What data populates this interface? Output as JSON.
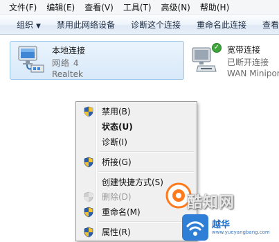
{
  "menubar": {
    "items": [
      "文件(F)",
      "编辑(E)",
      "查看(V)",
      "工具(T)",
      "高级(N)",
      "帮助(H)"
    ]
  },
  "commandbar": {
    "items": [
      "组织",
      "禁用此网络设备",
      "诊断这个连接",
      "重命名此连接",
      "查看"
    ]
  },
  "connections": {
    "local": {
      "name": "本地连接",
      "status": "网络 4",
      "device": "Realtek"
    },
    "broadband": {
      "name": "宽带连接",
      "status": "已断开连接",
      "device": "WAN Minipor"
    }
  },
  "context_menu": {
    "disable": "禁用(B)",
    "status": "状态(U)",
    "diagnose": "诊断(I)",
    "bridge": "桥接(G)",
    "shortcut": "创建快捷方式(S)",
    "delete": "删除(D)",
    "rename": "重命名(M)",
    "properties": "属性(R)"
  },
  "watermark": {
    "line1": "酷知网",
    "line2": "越华",
    "line3": "www.yueyangbang.com"
  },
  "colors": {
    "selection_fill": "#d8e9f9",
    "selection_border": "#9ac3e8",
    "menu_bg": "#f0f0f0",
    "disabled_text": "#9a9a9a"
  }
}
